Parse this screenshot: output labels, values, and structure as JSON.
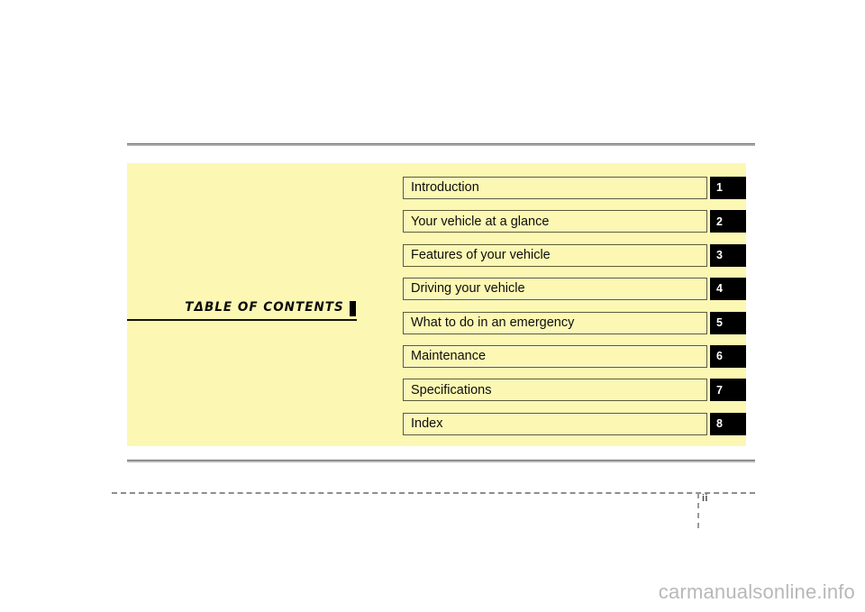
{
  "page": {
    "folio": "ii",
    "watermark": "carmanualsonline.info",
    "background_color": "#ffffff",
    "panel_color": "#fcf8b4",
    "rule_color": "#6e6e6e",
    "badge_color": "#000000",
    "badge_text_color": "#ffffff"
  },
  "heading": {
    "title": "TΔBLE  OF  CONTENTS",
    "marker_icon": "black-square-marker-icon"
  },
  "contents": {
    "rows": [
      {
        "label": "Introduction",
        "number": "1"
      },
      {
        "label": "Your vehicle at a glance",
        "number": "2"
      },
      {
        "label": "Features of your vehicle",
        "number": "3"
      },
      {
        "label": "Driving your vehicle",
        "number": "4"
      },
      {
        "label": "What to do in an emergency",
        "number": "5"
      },
      {
        "label": "Maintenance",
        "number": "6"
      },
      {
        "label": "Specifications",
        "number": "7"
      },
      {
        "label": "Index",
        "number": "8"
      }
    ]
  }
}
